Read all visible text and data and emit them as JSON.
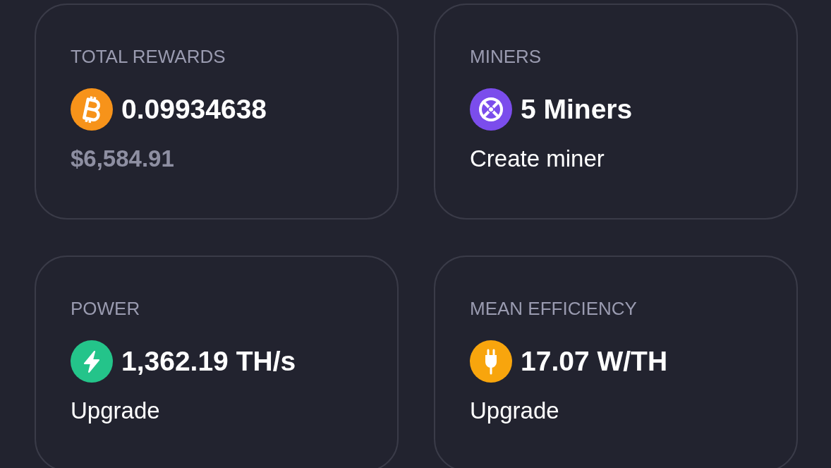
{
  "cards": [
    {
      "label": "TOTAL REWARDS",
      "kind": "rewards",
      "value": "0.09934638",
      "footer": {
        "kind": "amount",
        "text": "$6,584.91"
      }
    },
    {
      "label": "MINERS",
      "kind": "miners",
      "value": "5 Miners",
      "footer": {
        "kind": "action",
        "text": "Create miner"
      }
    },
    {
      "label": "POWER",
      "kind": "power",
      "value": "1,362.19 TH/s",
      "footer": {
        "kind": "action",
        "text": "Upgrade"
      }
    },
    {
      "label": "MEAN EFFICIENCY",
      "kind": "efficiency",
      "value": "17.07 W/TH",
      "footer": {
        "kind": "action",
        "text": "Upgrade"
      }
    }
  ]
}
